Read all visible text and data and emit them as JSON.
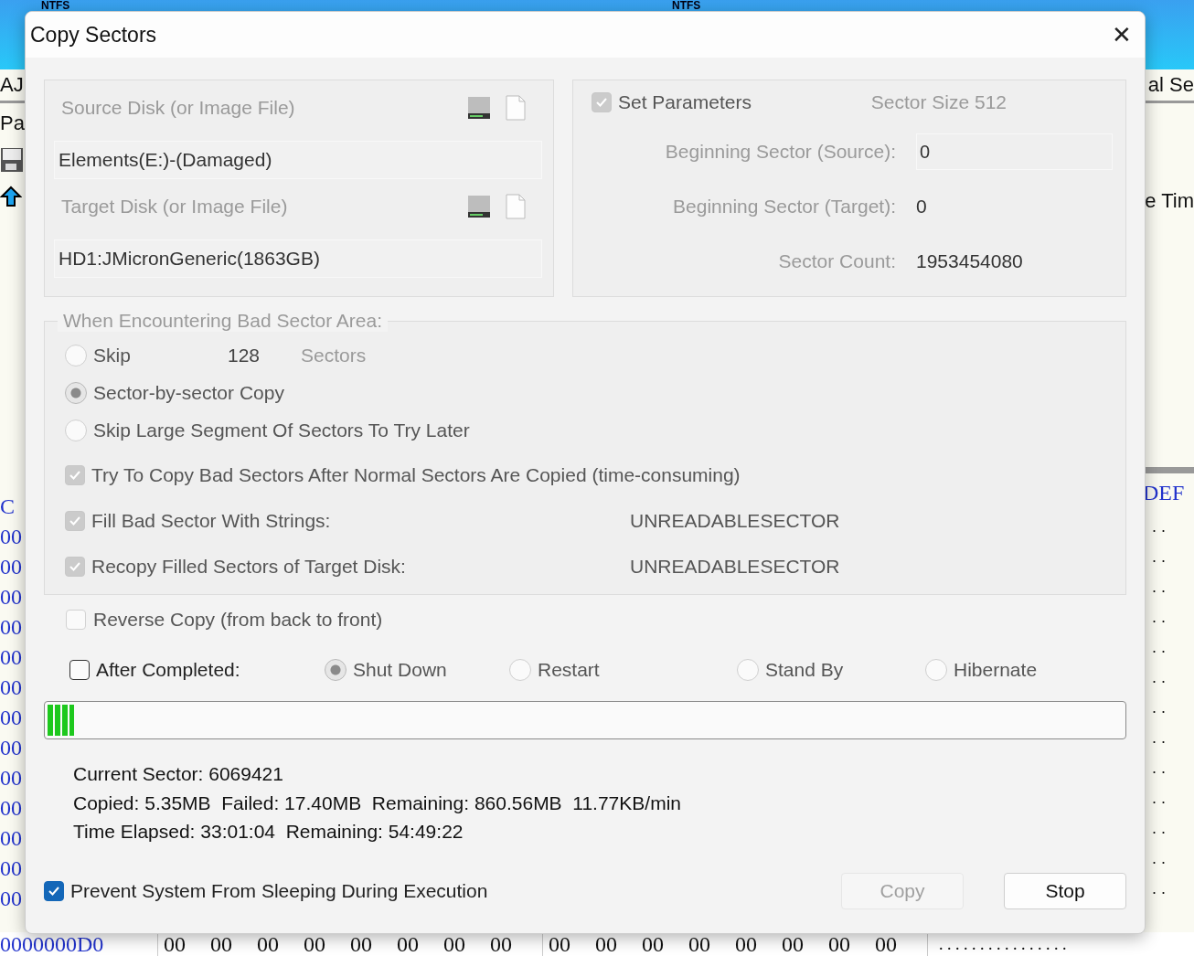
{
  "background_app": {
    "tab_labels": [
      "NTFS",
      "NTFS"
    ],
    "left_labels": [
      "AJ",
      "Pa"
    ],
    "right_labels": [
      "al Se",
      "e Tim"
    ],
    "hex_header_left": "C",
    "hex_header_right": "DEF",
    "left_hex_cells": [
      "00",
      "00",
      "00",
      "00",
      "00",
      "00",
      "00",
      "00",
      "00",
      "00",
      "00",
      "00",
      "00"
    ],
    "right_ascii_cells": [
      ". .",
      ". .",
      ". .",
      ". .",
      ". .",
      ". .",
      ". .",
      ". .",
      ". .",
      ". .",
      ". .",
      ". .",
      ". ."
    ],
    "bottom_row": {
      "offset": "0000000D0",
      "bytes": [
        "00",
        "00",
        "00",
        "00",
        "00",
        "00",
        "00",
        "00",
        "00",
        "00",
        "00",
        "00",
        "00",
        "00",
        "00",
        "00"
      ],
      "ascii": ". . . . . . . . . . . . . . . ."
    }
  },
  "dialog": {
    "title": "Copy Sectors",
    "close": "✕",
    "source": {
      "label": "Source Disk (or Image File)",
      "value": "Elements(E:)-(Damaged)",
      "disabled": true
    },
    "target": {
      "label": "Target Disk (or Image File)",
      "value": "HD1:JMicronGeneric(1863GB)",
      "disabled": true
    },
    "parameters": {
      "label": "Set Parameters",
      "checked": true,
      "disabled": true,
      "sector_size": "Sector Size 512",
      "fields": [
        {
          "label": "Beginning Sector (Source):",
          "value": "0",
          "kind": "input"
        },
        {
          "label": "Beginning Sector (Target):",
          "value": "0",
          "kind": "text"
        },
        {
          "label": "Sector Count:",
          "value": "1953454080",
          "kind": "text"
        }
      ]
    },
    "bad_sector": {
      "legend": "When Encountering Bad Sector Area:",
      "disabled": true,
      "skip_count": "128",
      "skip_unit": "Sectors",
      "options": [
        {
          "label": "Skip",
          "selected": false
        },
        {
          "label": "Sector-by-sector Copy",
          "selected": true
        },
        {
          "label": "Skip Large Segment Of Sectors To Try Later",
          "selected": false
        }
      ],
      "checks": [
        {
          "label": "Try To Copy Bad Sectors After Normal Sectors Are Copied (time-consuming)",
          "checked": true
        },
        {
          "label": "Fill Bad Sector With Strings:",
          "checked": true,
          "value": "UNREADABLESECTOR"
        },
        {
          "label": "Recopy Filled Sectors of Target Disk:",
          "checked": true,
          "value": "UNREADABLESECTOR"
        }
      ]
    },
    "reverse_copy": {
      "label": "Reverse Copy (from back to front)",
      "checked": false,
      "disabled": true
    },
    "after_completed": {
      "label": "After Completed:",
      "checked": false,
      "options": [
        {
          "label": "Shut Down",
          "selected": true
        },
        {
          "label": "Restart",
          "selected": false
        },
        {
          "label": "Stand By",
          "selected": false
        },
        {
          "label": "Hibernate",
          "selected": false
        }
      ]
    },
    "progress": {
      "level": 0.025
    },
    "status_lines": [
      "Current Sector: 6069421",
      "Copied: 5.35MB  Failed: 17.40MB  Remaining: 860.56MB  11.77KB/min",
      "Time Elapsed: 33:01:04  Remaining: 54:49:22"
    ],
    "prevent_sleep": {
      "label": "Prevent System From Sleeping During Execution",
      "checked": true
    },
    "buttons": [
      {
        "label": "Copy",
        "disabled": true
      },
      {
        "label": "Stop",
        "disabled": false
      }
    ]
  }
}
